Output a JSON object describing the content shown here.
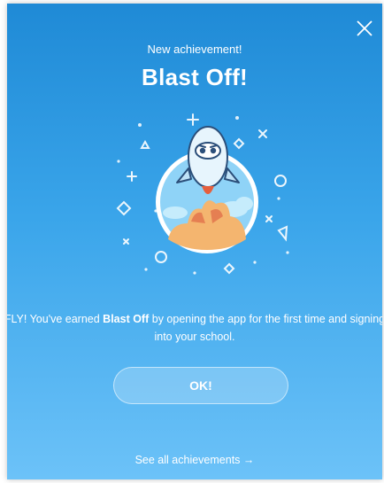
{
  "modal": {
    "kicker": "New achievement!",
    "title": "Blast Off!",
    "description": {
      "prefix": "FLY! You've earned ",
      "badge_name": "Blast Off",
      "suffix": " by opening the app for the first time and signing into your school."
    },
    "ok_label": "OK!",
    "footer_link": "See all achievements →"
  },
  "icons": {
    "close": "close-icon",
    "badge": "rocket-badge-icon"
  },
  "colors": {
    "gradient_top": "#1f8ad6",
    "gradient_bottom": "#6cc2f8",
    "text": "#ffffff"
  }
}
